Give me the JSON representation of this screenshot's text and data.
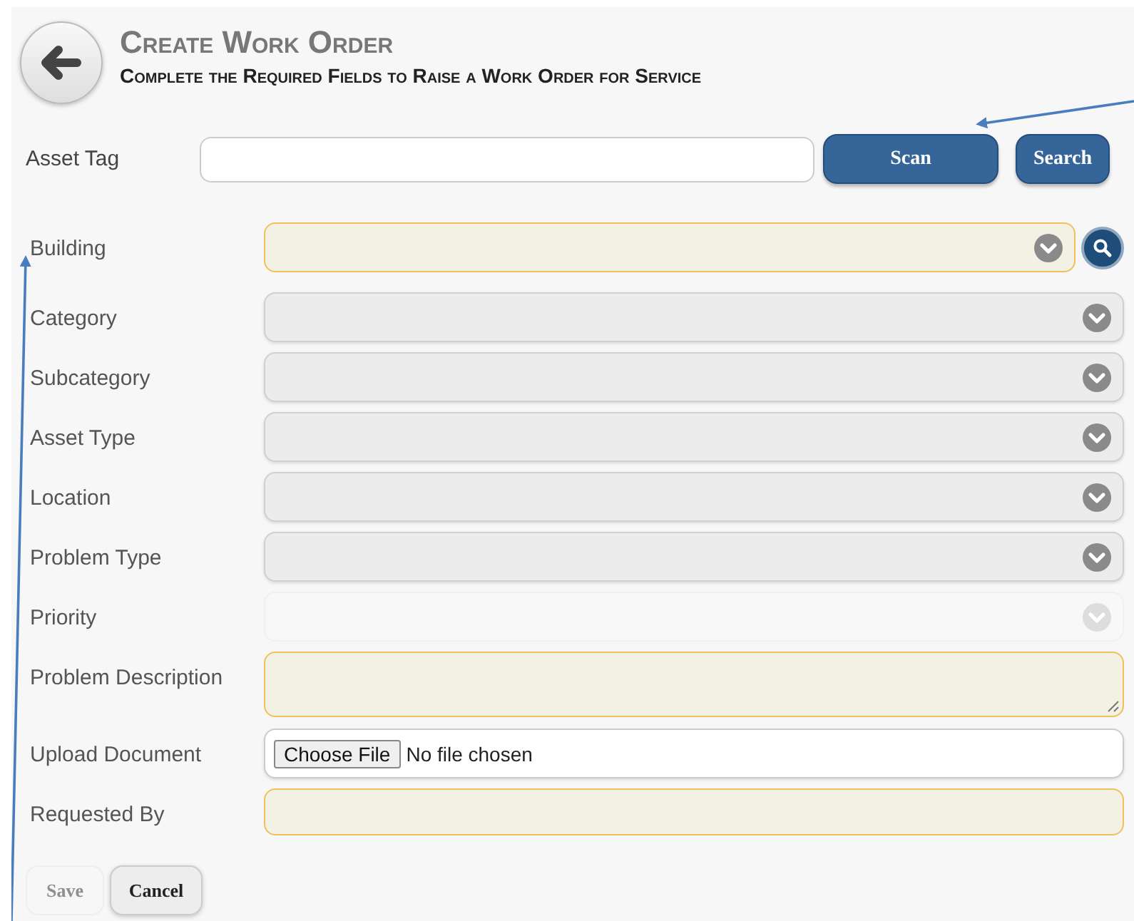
{
  "header": {
    "title": "Create Work Order",
    "subtitle": "Complete the Required Fields to Raise a Work Order for Service"
  },
  "asset_tag": {
    "label": "Asset Tag",
    "buttons": [
      "Scan",
      "Search"
    ]
  },
  "fields": [
    {
      "label": "Building",
      "kind": "select",
      "required": true,
      "disabled": false,
      "lookup": true
    },
    {
      "label": "Category",
      "kind": "select",
      "required": false,
      "disabled": false
    },
    {
      "label": "Subcategory",
      "kind": "select",
      "required": false,
      "disabled": false
    },
    {
      "label": "Asset Type",
      "kind": "select",
      "required": false,
      "disabled": false
    },
    {
      "label": "Location",
      "kind": "select",
      "required": false,
      "disabled": false
    },
    {
      "label": "Problem Type",
      "kind": "select",
      "required": false,
      "disabled": false
    },
    {
      "label": "Priority",
      "kind": "select",
      "required": false,
      "disabled": true
    },
    {
      "label": "Problem Description",
      "kind": "textarea",
      "required": true,
      "disabled": false
    },
    {
      "label": "Upload Document",
      "kind": "file",
      "required": false,
      "disabled": false,
      "button": "Choose File",
      "status": "No file chosen"
    },
    {
      "label": "Requested By",
      "kind": "text",
      "required": true,
      "disabled": false
    }
  ],
  "actions": [
    {
      "label": "Save",
      "disabled": true
    },
    {
      "label": "Cancel",
      "disabled": false
    }
  ]
}
